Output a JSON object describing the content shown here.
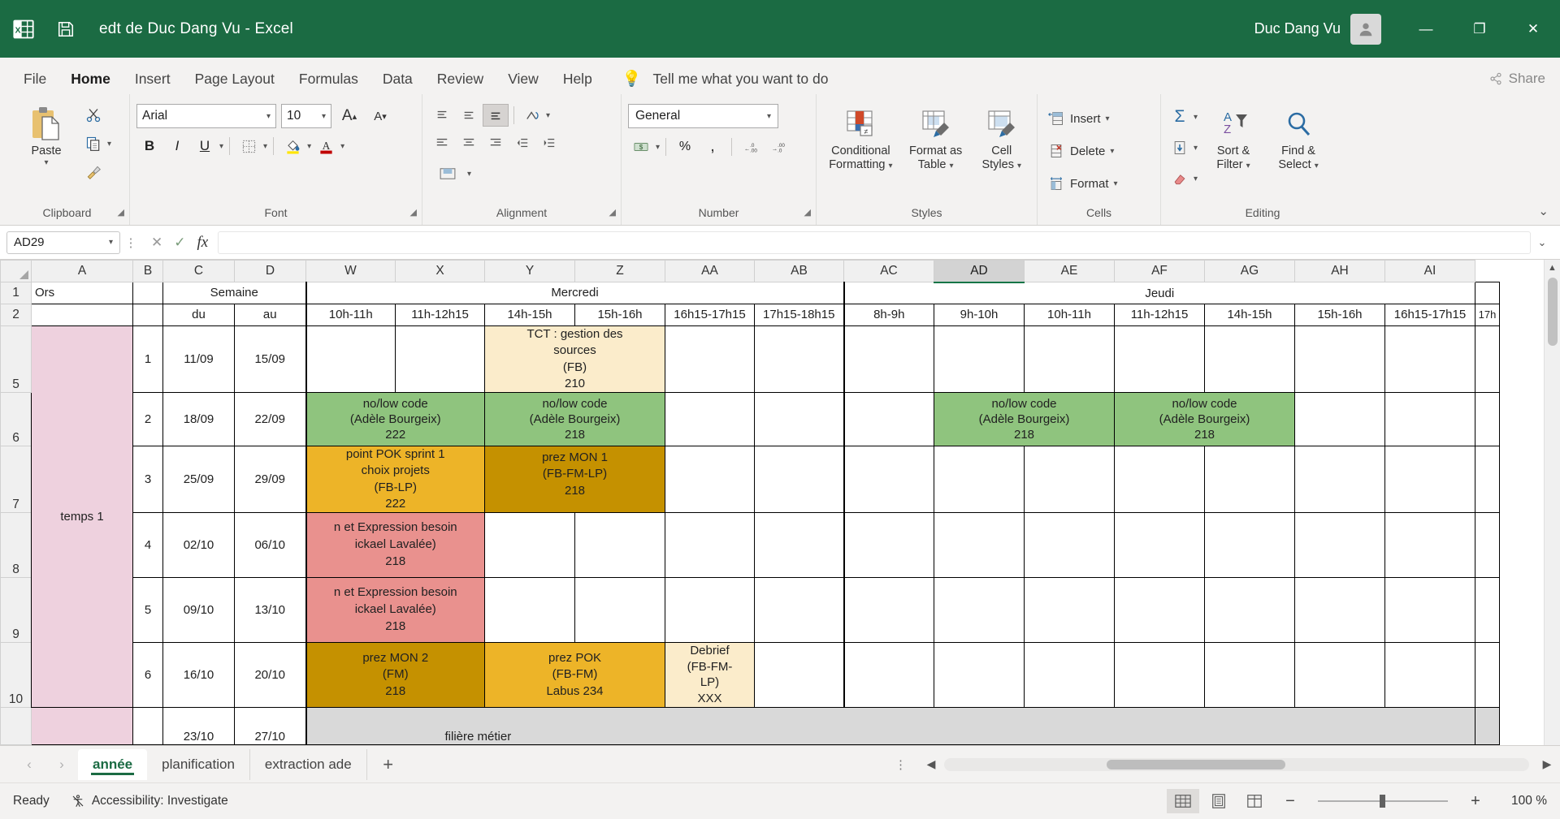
{
  "titlebar": {
    "app_icon": "excel-icon",
    "save_icon": "save-icon",
    "title": "edt de Duc Dang Vu  -  Excel",
    "user_name": "Duc Dang Vu",
    "minimize": "—",
    "restore": "❐",
    "close": "✕"
  },
  "ribbon_tabs": {
    "items": [
      "File",
      "Home",
      "Insert",
      "Page Layout",
      "Formulas",
      "Data",
      "Review",
      "View",
      "Help"
    ],
    "active": "Home",
    "tell_me": "Tell me what you want to do",
    "share": "Share"
  },
  "ribbon": {
    "clipboard": {
      "group_label": "Clipboard",
      "paste": "Paste",
      "cut": "Cut",
      "copy": "Copy",
      "format_painter": "Format Painter"
    },
    "font": {
      "group_label": "Font",
      "font_name": "Arial",
      "font_size": "10",
      "grow_font": "A",
      "shrink_font": "A",
      "bold": "B",
      "italic": "I",
      "underline": "U",
      "borders": "Borders",
      "fill_color": "Fill Color",
      "font_color": "A"
    },
    "alignment": {
      "group_label": "Alignment",
      "orientation": "ab",
      "wrap_text": "Wrap Text",
      "merge": "Merge & Center"
    },
    "number": {
      "group_label": "Number",
      "format": "General",
      "accounting": "Accounting",
      "percent": "%",
      "comma": ",",
      "increase_decimal": ".00",
      "decrease_decimal": ".00"
    },
    "styles": {
      "group_label": "Styles",
      "conditional": "Conditional\nFormatting",
      "conditional_l1": "Conditional",
      "conditional_l2": "Formatting",
      "table_l1": "Format as",
      "table_l2": "Table",
      "cell_l1": "Cell",
      "cell_l2": "Styles"
    },
    "cells": {
      "group_label": "Cells",
      "insert": "Insert",
      "delete": "Delete",
      "format": "Format"
    },
    "editing": {
      "group_label": "Editing",
      "autosum": "Σ",
      "fill": "Fill",
      "clear": "Clear",
      "sort_l1": "Sort &",
      "sort_l2": "Filter",
      "find_l1": "Find &",
      "find_l2": "Select"
    },
    "collapse": "⌄"
  },
  "formula_bar": {
    "name_box": "AD29",
    "cancel_icon": "cancel-icon",
    "enter_icon": "confirm-icon",
    "function_icon": "fx",
    "formula_value": "",
    "expand": "⌄"
  },
  "grid": {
    "columns": [
      "A",
      "B",
      "C",
      "D",
      "W",
      "X",
      "Y",
      "Z",
      "AA",
      "AB",
      "AC",
      "AD",
      "AE",
      "AF",
      "AG",
      "AH",
      "AI"
    ],
    "selected_column": "AD",
    "row_numbers": [
      "1",
      "2",
      "5",
      "6",
      "7",
      "8",
      "9",
      "10",
      ""
    ],
    "row1": {
      "a": "Ors",
      "semaine": "Semaine",
      "mercredi": "Mercredi",
      "jeudi": "Jeudi"
    },
    "row2": {
      "du": "du",
      "au": "au",
      "mercredi_slots": [
        "10h-11h",
        "11h-12h15",
        "14h-15h",
        "15h-16h",
        "16h15-17h15",
        "17h15-18h15"
      ],
      "jeudi_slots": [
        "8h-9h",
        "9h-10h",
        "10h-11h",
        "11h-12h15",
        "14h-15h",
        "15h-16h",
        "16h15-17h15",
        "17h"
      ]
    },
    "temps_label": "temps 1",
    "filiere_label": "filière métier",
    "weeks": [
      {
        "num": "1",
        "du": "11/09",
        "au": "15/09"
      },
      {
        "num": "2",
        "du": "18/09",
        "au": "22/09"
      },
      {
        "num": "3",
        "du": "25/09",
        "au": "29/09"
      },
      {
        "num": "4",
        "du": "02/10",
        "au": "06/10"
      },
      {
        "num": "5",
        "du": "09/10",
        "au": "13/10"
      },
      {
        "num": "6",
        "du": "16/10",
        "au": "20/10"
      },
      {
        "num": "",
        "du": "23/10",
        "au": "27/10"
      }
    ],
    "events": {
      "tct": "TCT : gestion des\nsources\n(FB)\n210",
      "nolow_w_r6": "no/low code\n(Adèle Bourgeix)\n222",
      "nolow_yz_r6": "no/low code\n(Adèle Bourgeix)\n218",
      "nolow_aeaf_r6": "no/low code\n(Adèle Bourgeix)\n218",
      "nolow_agah_r6": "no/low code\n(Adèle Bourgeix)\n218",
      "pok_sprint": "point POK sprint 1\nchoix projets\n(FB-LP)\n222",
      "prez_mon1": "prez MON 1\n(FB-FM-LP)\n218",
      "expression_r8": "n et Expression besoin\nickael Lavalée)\n218",
      "expression_r8_real": "n et Expression besoin\nickael Lavalée)\n218",
      "expression_r9": "n et Expression besoin\nickael Lavalée)\n218",
      "prez_mon2": "prez MON 2\n(FM)\n218",
      "prez_pok": "prez POK\n(FB-FM)\nLabus 234",
      "debrief": "Debrief\n(FB-FM-\nLP)\nXXX"
    },
    "colors": {
      "cream": "#fbeccb",
      "green": "#8fc47e",
      "yellow": "#edb428",
      "dark_yellow": "#c59100",
      "salmon": "#e9918e",
      "pink": "#eed1de",
      "grey": "#d9d9d9"
    }
  },
  "sheet_tabs": {
    "prev": "‹",
    "next": "›",
    "items": [
      "année",
      "planification",
      "extraction ade"
    ],
    "active": "année",
    "add": "+",
    "more": "⋮"
  },
  "status_bar": {
    "ready": "Ready",
    "accessibility": "Accessibility: Investigate",
    "view_normal": "normal-view-icon",
    "view_pagelayout": "page-layout-icon",
    "view_pagebreak": "page-break-icon",
    "zoom_out": "−",
    "zoom_in": "+",
    "zoom_level": "100 %"
  }
}
